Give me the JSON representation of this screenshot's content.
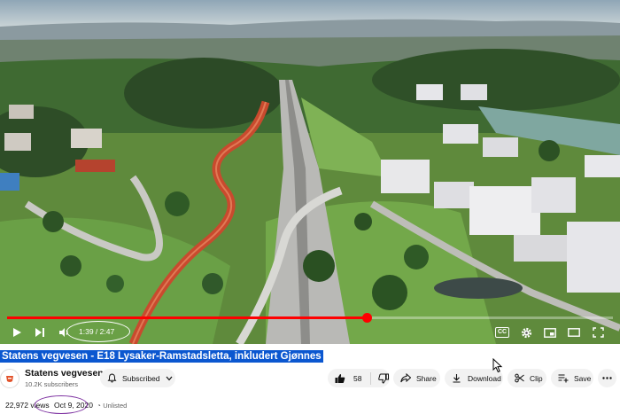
{
  "player": {
    "time_display": "1:39 / 2:47",
    "progress": 0.593,
    "icons": {
      "play": "play-icon",
      "next": "next-icon",
      "volume": "volume-icon",
      "captions": "captions-icon",
      "settings": "gear-icon",
      "miniplayer": "miniplayer-icon",
      "theater": "theater-icon",
      "fullscreen": "fullscreen-icon"
    },
    "captions_label": "CC"
  },
  "video": {
    "title": "Statens vegvesen - E18 Lysaker-Ramstadsletta, inkludert Gjønnes"
  },
  "channel": {
    "name": "Statens vegvesen",
    "subscribers": "10.2K subscribers"
  },
  "actions": {
    "subscribed_label": "Subscribed",
    "like_count": "58",
    "share_label": "Share",
    "download_label": "Download",
    "clip_label": "Clip",
    "save_label": "Save"
  },
  "meta": {
    "views": "22,972 views",
    "date": "Oct 9, 2020",
    "visibility": "Unlisted"
  },
  "colors": {
    "progress": "#ff0000",
    "selection": "#0b57d0",
    "annotation_white": "#ffffff",
    "annotation_purple": "#7b2d9f"
  }
}
